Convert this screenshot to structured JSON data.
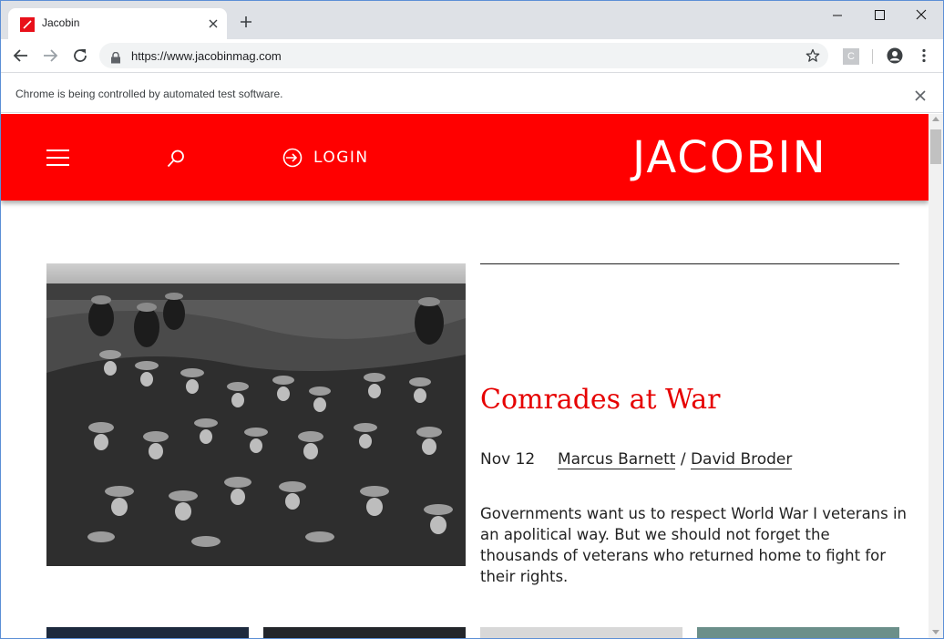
{
  "browser": {
    "tab_title": "Jacobin",
    "url": "https://www.jacobinmag.com",
    "ext_label": "C",
    "infobar_text": "Chrome is being controlled by automated test software."
  },
  "site": {
    "login_label": "LOGIN",
    "logo_text": "JACOBIN",
    "brand_color": "#ff0000"
  },
  "feature": {
    "headline": "Comrades at War",
    "date": "Nov 12",
    "author_1": "Marcus Barnett",
    "author_separator": " / ",
    "author_2": "David Broder",
    "teaser": "Governments want us to respect World War I veterans in an apolitical way. But we should not forget the thousands of veterans who returned home to fight for their rights."
  }
}
